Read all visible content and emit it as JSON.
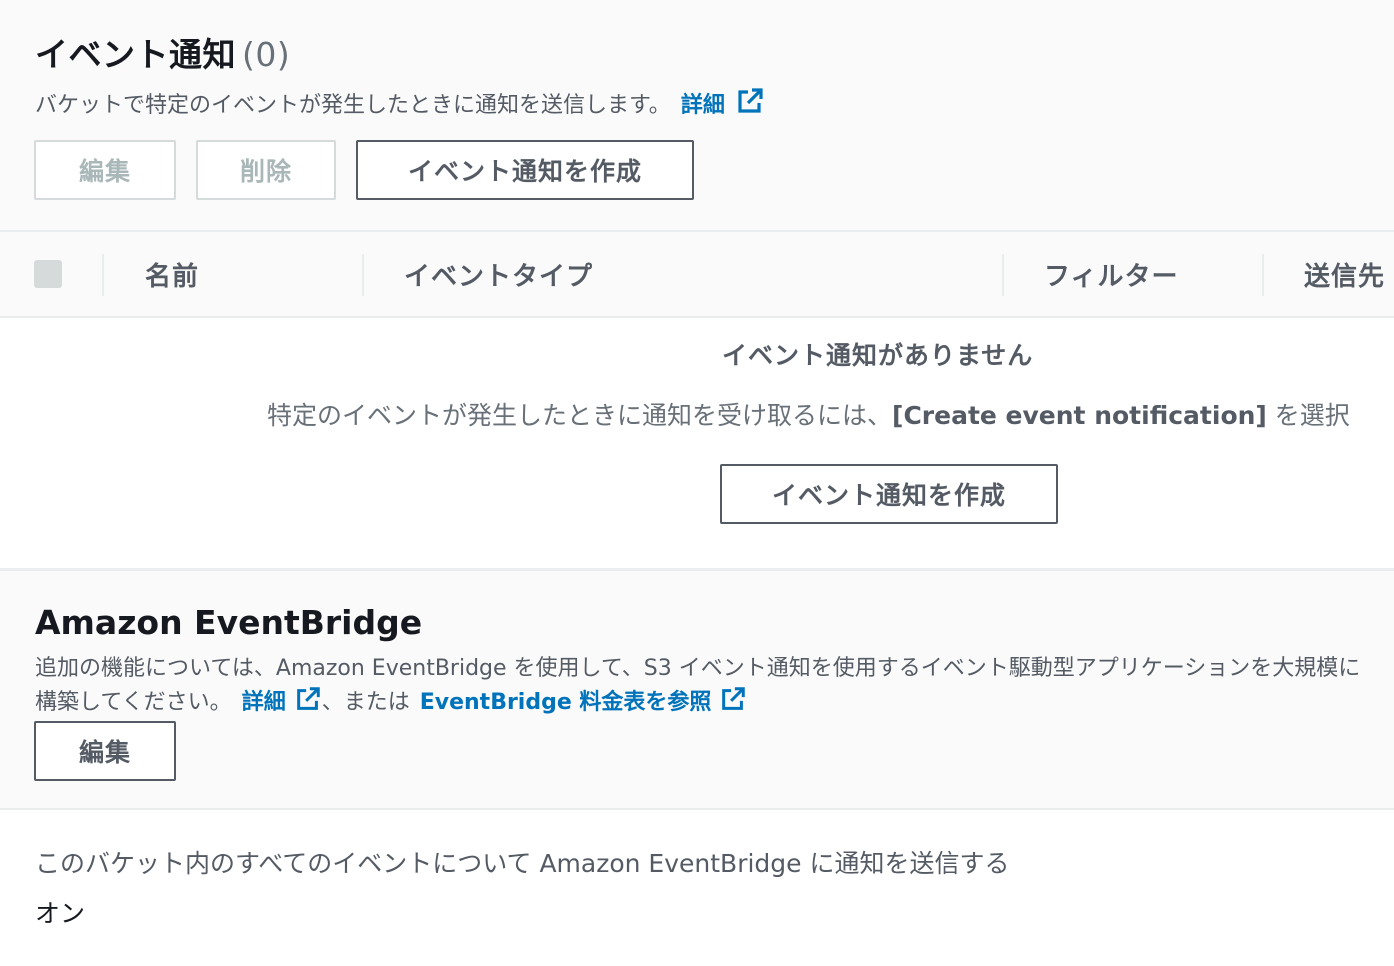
{
  "event_notifications": {
    "title": "イベント通知",
    "count": "(0)",
    "description": "バケットで特定のイベントが発生したときに通知を送信します。",
    "learn_more_label": "詳細",
    "buttons": {
      "edit": "編集",
      "delete": "削除",
      "create": "イベント通知を作成"
    },
    "table": {
      "columns": [
        "名前",
        "イベントタイプ",
        "フィルター",
        "送信先"
      ]
    },
    "empty_state": {
      "title": "イベント通知がありません",
      "description_prefix": "特定のイベントが発生したときに通知を受け取るには、",
      "description_bold": "[Create event notification]",
      "description_suffix": " を選択",
      "create_button": "イベント通知を作成"
    }
  },
  "eventbridge": {
    "title": "Amazon EventBridge",
    "description_part1": "追加の機能については、Amazon EventBridge を使用して、S3 イベント通知を使用するイベント駆動型アプリケーションを大規模に構築してください。",
    "learn_more_label": "詳細",
    "or_text": "、または",
    "pricing_link": "EventBridge 料金表を参照",
    "edit_button": "編集",
    "setting_label": "このバケット内のすべてのイベントについて Amazon EventBridge に通知を送信する",
    "setting_value": "オン"
  },
  "colors": {
    "link": "#0073bb",
    "text_secondary": "#545b64",
    "panel_bg": "#fafafa",
    "disabled": "#aab7b8"
  }
}
